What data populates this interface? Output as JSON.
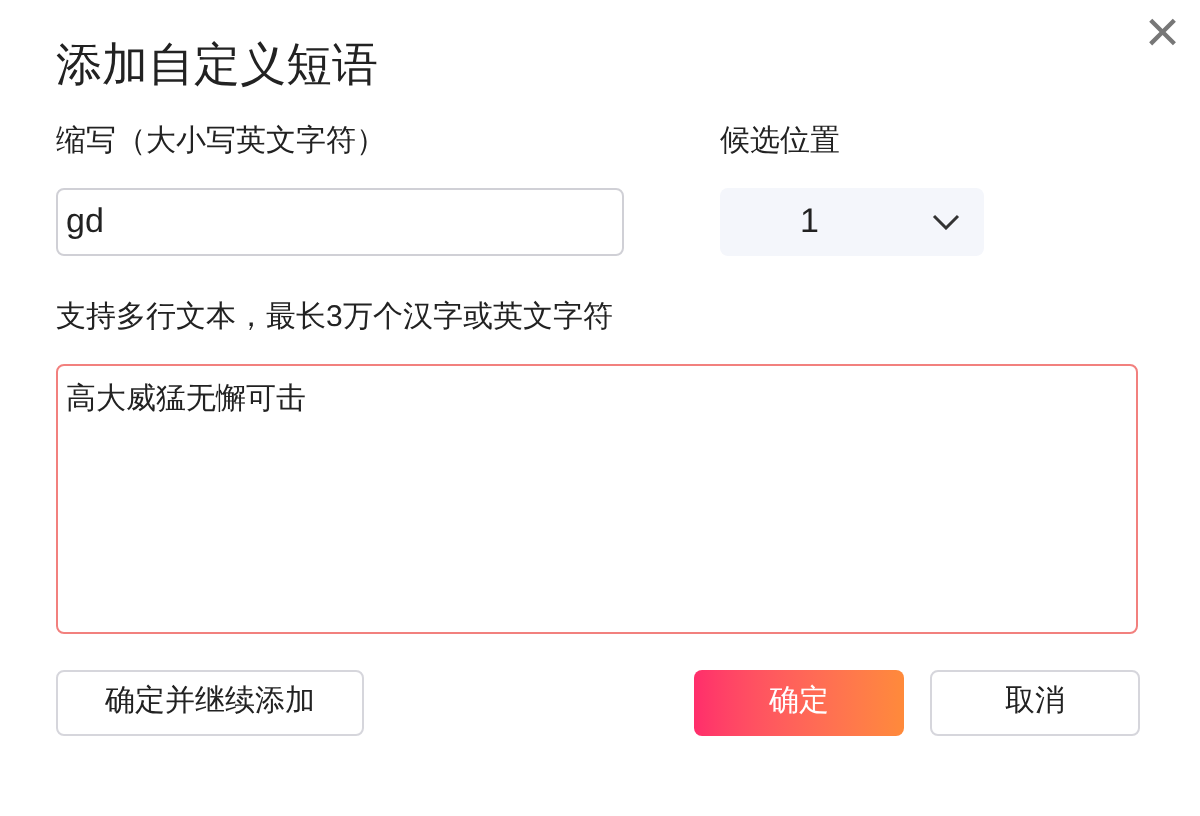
{
  "dialog": {
    "title": "添加自定义短语",
    "close": "×"
  },
  "abbreviation": {
    "label": "缩写（大小写英文字符）",
    "value": "gd"
  },
  "position": {
    "label": "候选位置",
    "value": "1"
  },
  "phrase": {
    "hint": "支持多行文本，最长3万个汉字或英文字符",
    "value": "高大威猛无懈可击"
  },
  "buttons": [
    {
      "label": "确定并继续添加",
      "kind": "secondary"
    },
    {
      "label": "确定",
      "kind": "primary"
    },
    {
      "label": "取消",
      "kind": "secondary"
    }
  ]
}
